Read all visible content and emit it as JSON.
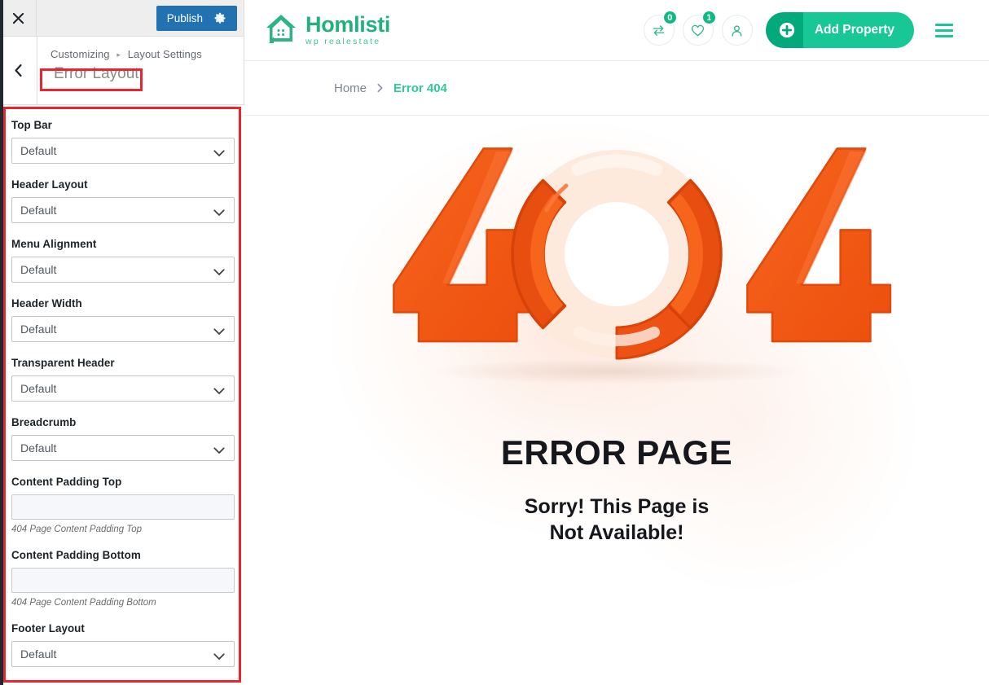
{
  "customizer": {
    "close_label": "Close customizer",
    "publish_label": "Publish",
    "gear_label": "Publish settings",
    "back_label": "Back",
    "breadcrumb_root": "Customizing",
    "breadcrumb_sep": "▸",
    "breadcrumb_parent": "Layout Settings",
    "panel_title": "Error Layout",
    "controls": [
      {
        "label": "Top Bar",
        "type": "select",
        "value": "Default",
        "name": "top-bar"
      },
      {
        "label": "Header Layout",
        "type": "select",
        "value": "Default",
        "name": "header-layout"
      },
      {
        "label": "Menu Alignment",
        "type": "select",
        "value": "Default",
        "name": "menu-alignment"
      },
      {
        "label": "Header Width",
        "type": "select",
        "value": "Default",
        "name": "header-width"
      },
      {
        "label": "Transparent Header",
        "type": "select",
        "value": "Default",
        "name": "transparent-header"
      },
      {
        "label": "Breadcrumb",
        "type": "select",
        "value": "Default",
        "name": "breadcrumb"
      },
      {
        "label": "Content Padding Top",
        "type": "text",
        "value": "",
        "desc": "404 Page Content Padding Top",
        "name": "content-padding-top"
      },
      {
        "label": "Content Padding Bottom",
        "type": "text",
        "value": "",
        "desc": "404 Page Content Padding Bottom",
        "name": "content-padding-bottom"
      },
      {
        "label": "Footer Layout",
        "type": "select",
        "value": "Default",
        "name": "footer-layout"
      }
    ],
    "highlight_color": "#e8262b"
  },
  "preview": {
    "logo": {
      "name": "Homlisti",
      "tagline": "wp realestate"
    },
    "header_icons": [
      {
        "name": "compare-icon",
        "badge": "0"
      },
      {
        "name": "wishlist-heart-icon",
        "badge": "1"
      },
      {
        "name": "user-account-icon",
        "badge": ""
      }
    ],
    "add_property_label": "Add Property",
    "menu_label": "Menu",
    "breadcrumb": {
      "home": "Home",
      "current": "Error 404"
    },
    "error": {
      "code": "404",
      "title": "ERROR PAGE",
      "subtitle_line1": "Sorry! This Page is",
      "subtitle_line2": "Not Available!"
    },
    "colors": {
      "brand_green": "#17c795",
      "brand_green_dark": "#02a97a",
      "logo_green": "#22b07d",
      "error_orange": "#f4601c",
      "error_orange_dark": "#e14a0c",
      "error_cream": "#fdeadd"
    }
  }
}
